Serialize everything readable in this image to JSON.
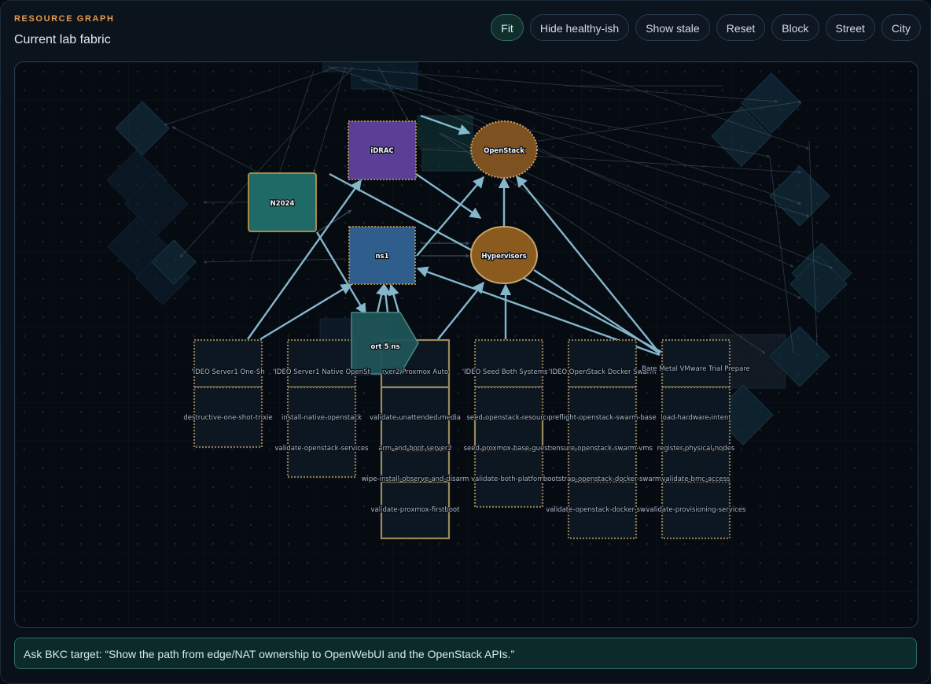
{
  "header": {
    "eyebrow": "RESOURCE GRAPH",
    "title": "Current lab fabric"
  },
  "toolbar": [
    {
      "id": "fit",
      "label": "Fit",
      "active": true
    },
    {
      "id": "hide-healthy",
      "label": "Hide healthy-ish",
      "active": false
    },
    {
      "id": "show-stale",
      "label": "Show stale",
      "active": false
    },
    {
      "id": "reset",
      "label": "Reset",
      "active": false
    },
    {
      "id": "block",
      "label": "Block",
      "active": false
    },
    {
      "id": "street",
      "label": "Street",
      "active": false
    },
    {
      "id": "city",
      "label": "City",
      "active": false
    }
  ],
  "graph": {
    "nodes": {
      "idrac": "iDRAC",
      "openstack": "OpenStack",
      "n2024": "N2024",
      "ns1": "ns1",
      "hypervisors": "Hypervisors",
      "port5": "ort 5 ns"
    },
    "workflows": [
      {
        "title": "'IDEO Server1 One-Sh",
        "tasks": [
          "destructive-one-shot-trixie"
        ]
      },
      {
        "title": "'IDEO Server1 Native OpenSt",
        "tasks": [
          "install-native-openstack",
          "validate-openstack-services"
        ]
      },
      {
        "title": "rver2 Proxmox Auto",
        "tasks": [
          "validate-unattended-media",
          "arm-and-boot-server2",
          "wipe-install-observe-and-disarm",
          "validate-proxmox-firstboot"
        ]
      },
      {
        "title": "'IDEO Seed Both Systems +",
        "tasks": [
          "seed-openstack-resource",
          "seed-proxmox-base-guests",
          "validate-both-platform"
        ]
      },
      {
        "title": "'IDEO OpenStack Docker Swarm",
        "tasks": [
          "preflight-openstack-swarm-base",
          "ensure-openstack-swarm-vms",
          "bootstrap-openstack-docker-swarm",
          "validate-openstack-docker-swarm"
        ]
      },
      {
        "title": "Bare Metal VMware Trial Prepare",
        "tasks": [
          "load-hardware-intent",
          "register-physical-nodes",
          "validate-bmc-access",
          "validate-provisioning-services"
        ]
      }
    ]
  },
  "ask": {
    "text": "Ask BKC target: “Show the path from edge/NAT ownership to OpenWebUI and the OpenStack APIs.”"
  },
  "colors": {
    "accent": "#e89a4e",
    "edge": "#8fc6dc",
    "idrac": "#5b3f96",
    "n2024": "#1f6a66",
    "ns1": "#2f5d8c",
    "hypervisor": "#8a5a1f",
    "task_border": "#8d7a50"
  }
}
